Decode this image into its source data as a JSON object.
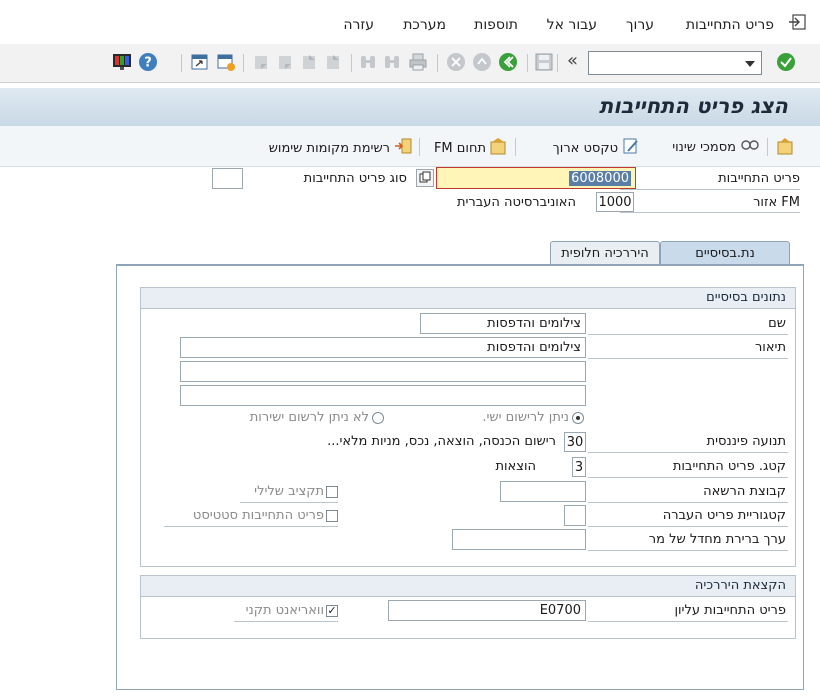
{
  "menu": {
    "items": [
      "פריט התחייבות",
      "ערוך",
      "עבור אל",
      "תוספות",
      "מערכת",
      "עזרה"
    ]
  },
  "toolbar": {
    "command_field_value": "",
    "command_field_placeholder": "",
    "chevron_label": "«"
  },
  "title": "הצג פריט התחייבות",
  "app_toolbar": {
    "change_docs": "מסמכי שינוי",
    "long_text": "טקסט ארוך",
    "fm_area": "תחום FM",
    "where_used": "רשימת מקומות שימוש"
  },
  "header": {
    "commitment_item_label": "פריט התחייבות",
    "commitment_item_value": "6008000",
    "commitment_item_type_label": "סוג פריט התחייבות",
    "commitment_item_type_value": "",
    "fm_area_label": "אזור FM",
    "fm_area_value": "1000",
    "fm_area_name": "האוניברסיטה העברית"
  },
  "tabs": {
    "basic": "נת.בסיסיים",
    "alt_hierarchy": "היררכיה חלופית"
  },
  "basic_data": {
    "group_title": "נתונים בסיסיים",
    "name_label": "שם",
    "name_value": "צילומים והדפסות",
    "description_label": "תיאור",
    "description_value": "צילומים והדפסות",
    "description_line2": "",
    "description_line3": "",
    "radio_direct_posting": "ניתן לרישום ישי.",
    "radio_no_direct_posting": "לא ניתן לרשום ישירות",
    "financial_trans_label": "תנועה פיננסית",
    "financial_trans_value": "30",
    "financial_trans_text": "רישום הכנסה, הוצאה, נכס, מניות מלאי...",
    "item_category_label": "קטג. פריט התחייבות",
    "item_category_value": "3",
    "item_category_text": "הוצאות",
    "auth_group_label": "קבוצת הרשאה",
    "auth_group_value": "",
    "neg_budget_label": "תקציב שלילי",
    "transfer_cat_label": "קטגוריית פריט העברה",
    "transfer_cat_value": "",
    "statistical_label": "פריט התחייבות סטטיסט",
    "default_value_label": "ערך ברירת מחדל של מר",
    "default_value_value": ""
  },
  "hierarchy": {
    "group_title": "הקצאת היררכיה",
    "superior_label": "פריט התחייבות עליון",
    "superior_value": "E0700",
    "standard_variant_label": "וואריאנט תקני",
    "standard_variant_checked": "✓"
  },
  "colors": {
    "title_bar": "#c9d9e6",
    "focused_field": "#fff5b8",
    "tab_active": "#c9daea"
  }
}
